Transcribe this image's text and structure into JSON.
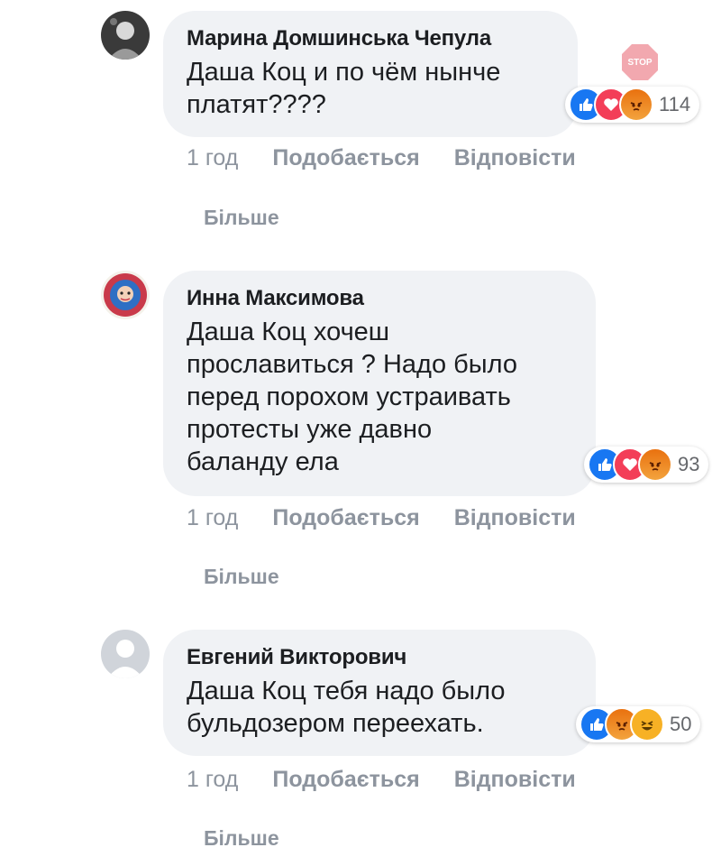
{
  "comments": [
    {
      "author": "Марина Домшинська Чепула",
      "text": "Даша Коц и по чём нынче\nплатят????",
      "reaction_count": "114",
      "reactions": [
        "like-icon",
        "love-icon",
        "angry-icon"
      ],
      "time": "1 год",
      "like_label": "Подобається",
      "reply_label": "Відповісти",
      "more_label": "Більше"
    },
    {
      "author": "Инна Максимова",
      "text": "Даша Коц хочеш\nпрославиться ? Надо было\nперед порохом устраивать\nпротесты уже давно\nбаланду ела",
      "reaction_count": "93",
      "reactions": [
        "like-icon",
        "love-icon",
        "angry-icon"
      ],
      "time": "1 год",
      "like_label": "Подобається",
      "reply_label": "Відповісти",
      "more_label": "Більше"
    },
    {
      "author": "Евгений Викторович",
      "text": "Даша Коц тебя надо было\nбульдозером переехать.",
      "reaction_count": "50",
      "reactions": [
        "like-icon",
        "angry-icon",
        "haha-icon"
      ],
      "time": "1 год",
      "like_label": "Подобається",
      "reply_label": "Відповісти",
      "more_label": "Більше"
    }
  ],
  "watermark": {
    "text": "STOP",
    "color": "#e8606e"
  },
  "colors": {
    "bubble": "#f0f2f5",
    "meta_text": "#8d949e",
    "like": "#1877f2",
    "love": "#f33e58",
    "angry": "#e9710f"
  }
}
